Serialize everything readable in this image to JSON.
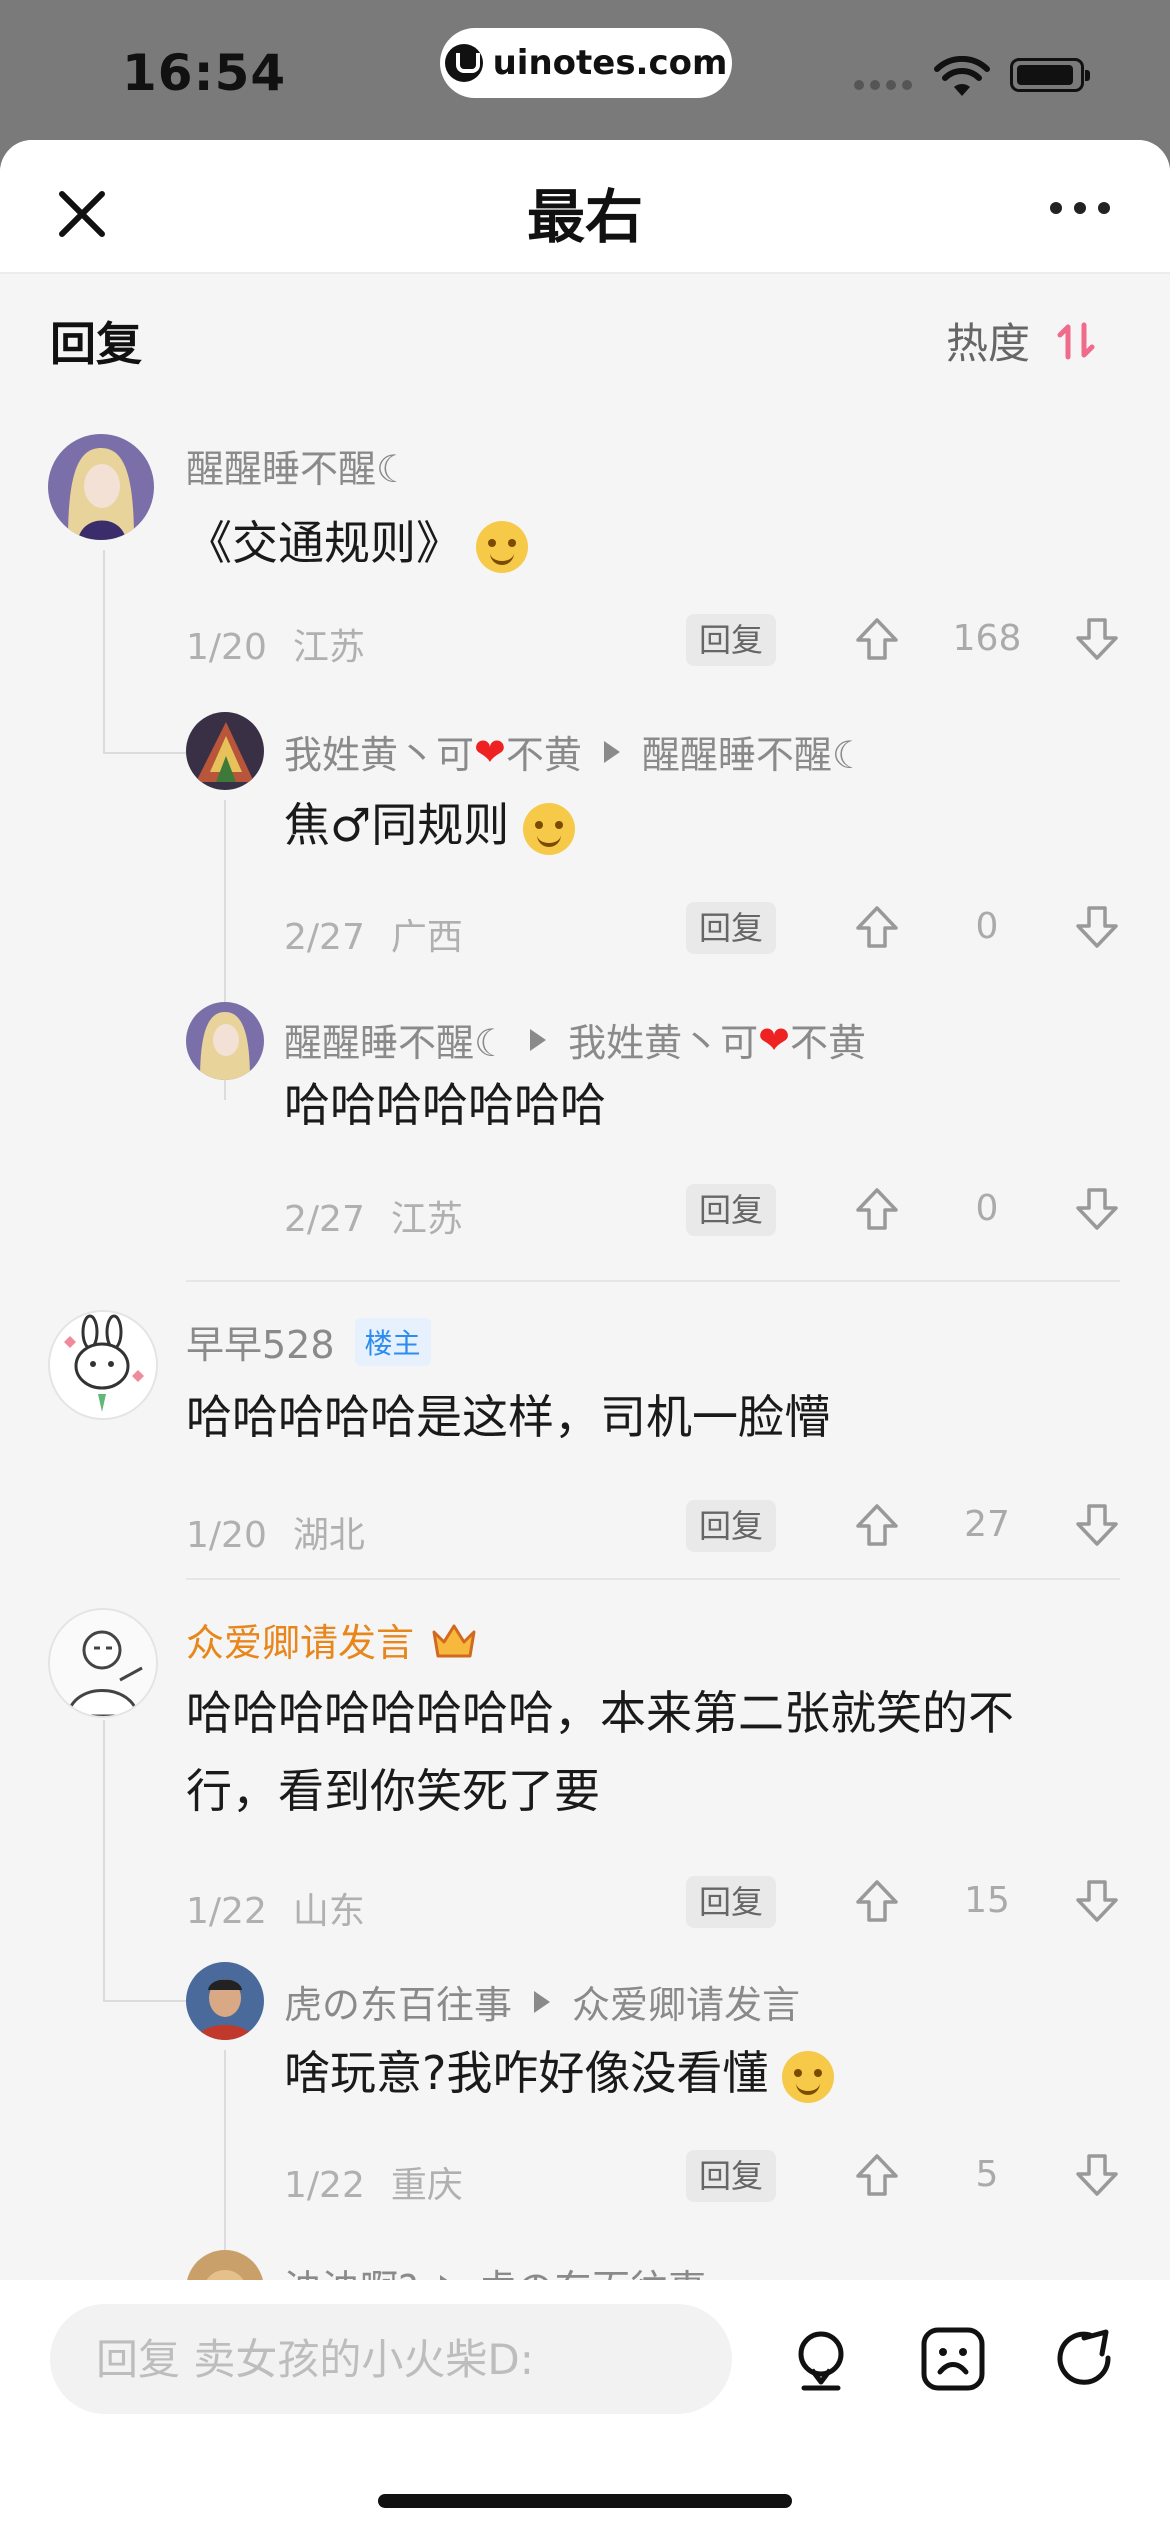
{
  "status_bar": {
    "time": "16:54",
    "url": "uinotes.com"
  },
  "nav": {
    "title": "最右"
  },
  "section": {
    "title": "回复",
    "sort_label": "热度"
  },
  "comments": [
    {
      "user": "醒醒睡不醒☾",
      "text": "《交通规则》",
      "date": "1/20",
      "location": "江苏",
      "reply": "回复",
      "likes": "168"
    },
    {
      "user": "我姓黄丶可",
      "user_tail": "不黄",
      "reply_to": "醒醒睡不醒☾",
      "text": "焦♂同规则",
      "date": "2/27",
      "location": "广西",
      "reply": "回复",
      "likes": "0"
    },
    {
      "user": "醒醒睡不醒☾",
      "reply_to": "我姓黄丶可",
      "reply_to_tail": "不黄",
      "text": "哈哈哈哈哈哈哈",
      "date": "2/27",
      "location": "江苏",
      "reply": "回复",
      "likes": "0"
    },
    {
      "user": "早早528",
      "badge": "楼主",
      "text": "哈哈哈哈哈是这样，司机一脸懵",
      "date": "1/20",
      "location": "湖北",
      "reply": "回复",
      "likes": "27"
    },
    {
      "user": "众爱卿请发言",
      "text_line1": "哈哈哈哈哈哈哈哈，本来第二张就笑的不",
      "text_line2": "行，看到你笑死了要",
      "date": "1/22",
      "location": "山东",
      "reply": "回复",
      "likes": "15"
    },
    {
      "user": "虎の东百往事",
      "reply_to": "众爱卿请发言",
      "text": "啥玩意?我咋好像没看懂",
      "date": "1/22",
      "location": "重庆",
      "reply": "回复",
      "likes": "5"
    }
  ],
  "partial_comment": {
    "user": "泱泱啊?",
    "reply_to": "虎の东百往事"
  },
  "bottom": {
    "placeholder": "回复 卖女孩的小火柴D:"
  },
  "colors": {
    "accent": "#e8861c",
    "badge": "#2d8cf0",
    "heart": "#e22222",
    "sort_icon": "#f06a8a"
  }
}
